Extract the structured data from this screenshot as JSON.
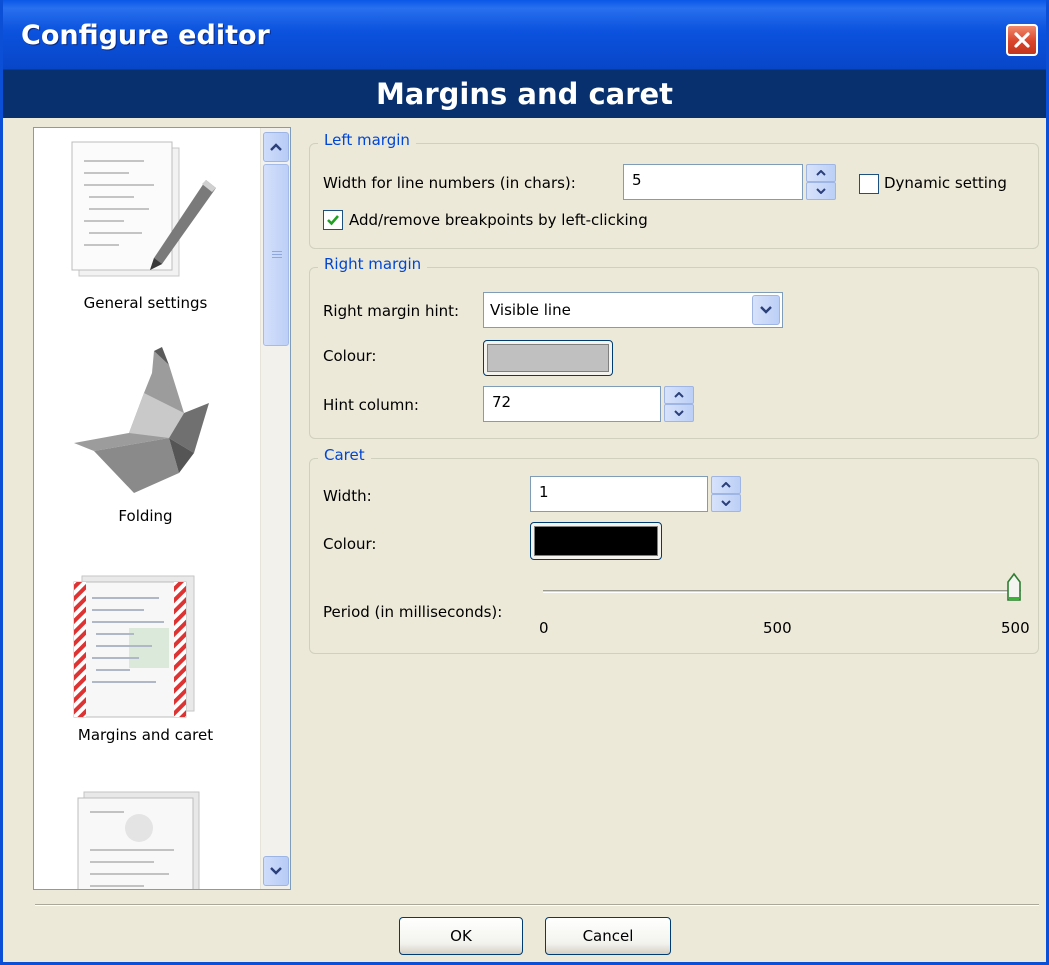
{
  "window": {
    "title": "Configure editor",
    "close_icon": "close-icon"
  },
  "header": {
    "title": "Margins and caret"
  },
  "categories": [
    {
      "label": "General settings",
      "icon": "general-settings-icon"
    },
    {
      "label": "Folding",
      "icon": "folding-icon"
    },
    {
      "label": "Margins and caret",
      "icon": "margins-caret-icon",
      "selected": true
    },
    {
      "label": "",
      "icon": "document-icon"
    }
  ],
  "left_margin": {
    "legend": "Left margin",
    "width_label": "Width for line numbers (in chars):",
    "width_value": "5",
    "dynamic_label": "Dynamic setting",
    "dynamic_checked": false,
    "breakpoints_label": "Add/remove breakpoints by left-clicking",
    "breakpoints_checked": true
  },
  "right_margin": {
    "legend": "Right margin",
    "hint_label": "Right margin hint:",
    "hint_value": "Visible line",
    "colour_label": "Colour:",
    "colour_value": "#c0c0c0",
    "column_label": "Hint column:",
    "column_value": "72"
  },
  "caret": {
    "legend": "Caret",
    "width_label": "Width:",
    "width_value": "1",
    "colour_label": "Colour:",
    "colour_value": "#000000",
    "period_label": "Period (in milliseconds):",
    "period_min": "0",
    "period_mid": "500",
    "period_max": "500",
    "period_fraction": 1.0
  },
  "buttons": {
    "ok": "OK",
    "cancel": "Cancel"
  },
  "colors": {
    "title_blue": "#0b52de",
    "header_navy": "#08306e",
    "legend_blue": "#0046d5"
  }
}
